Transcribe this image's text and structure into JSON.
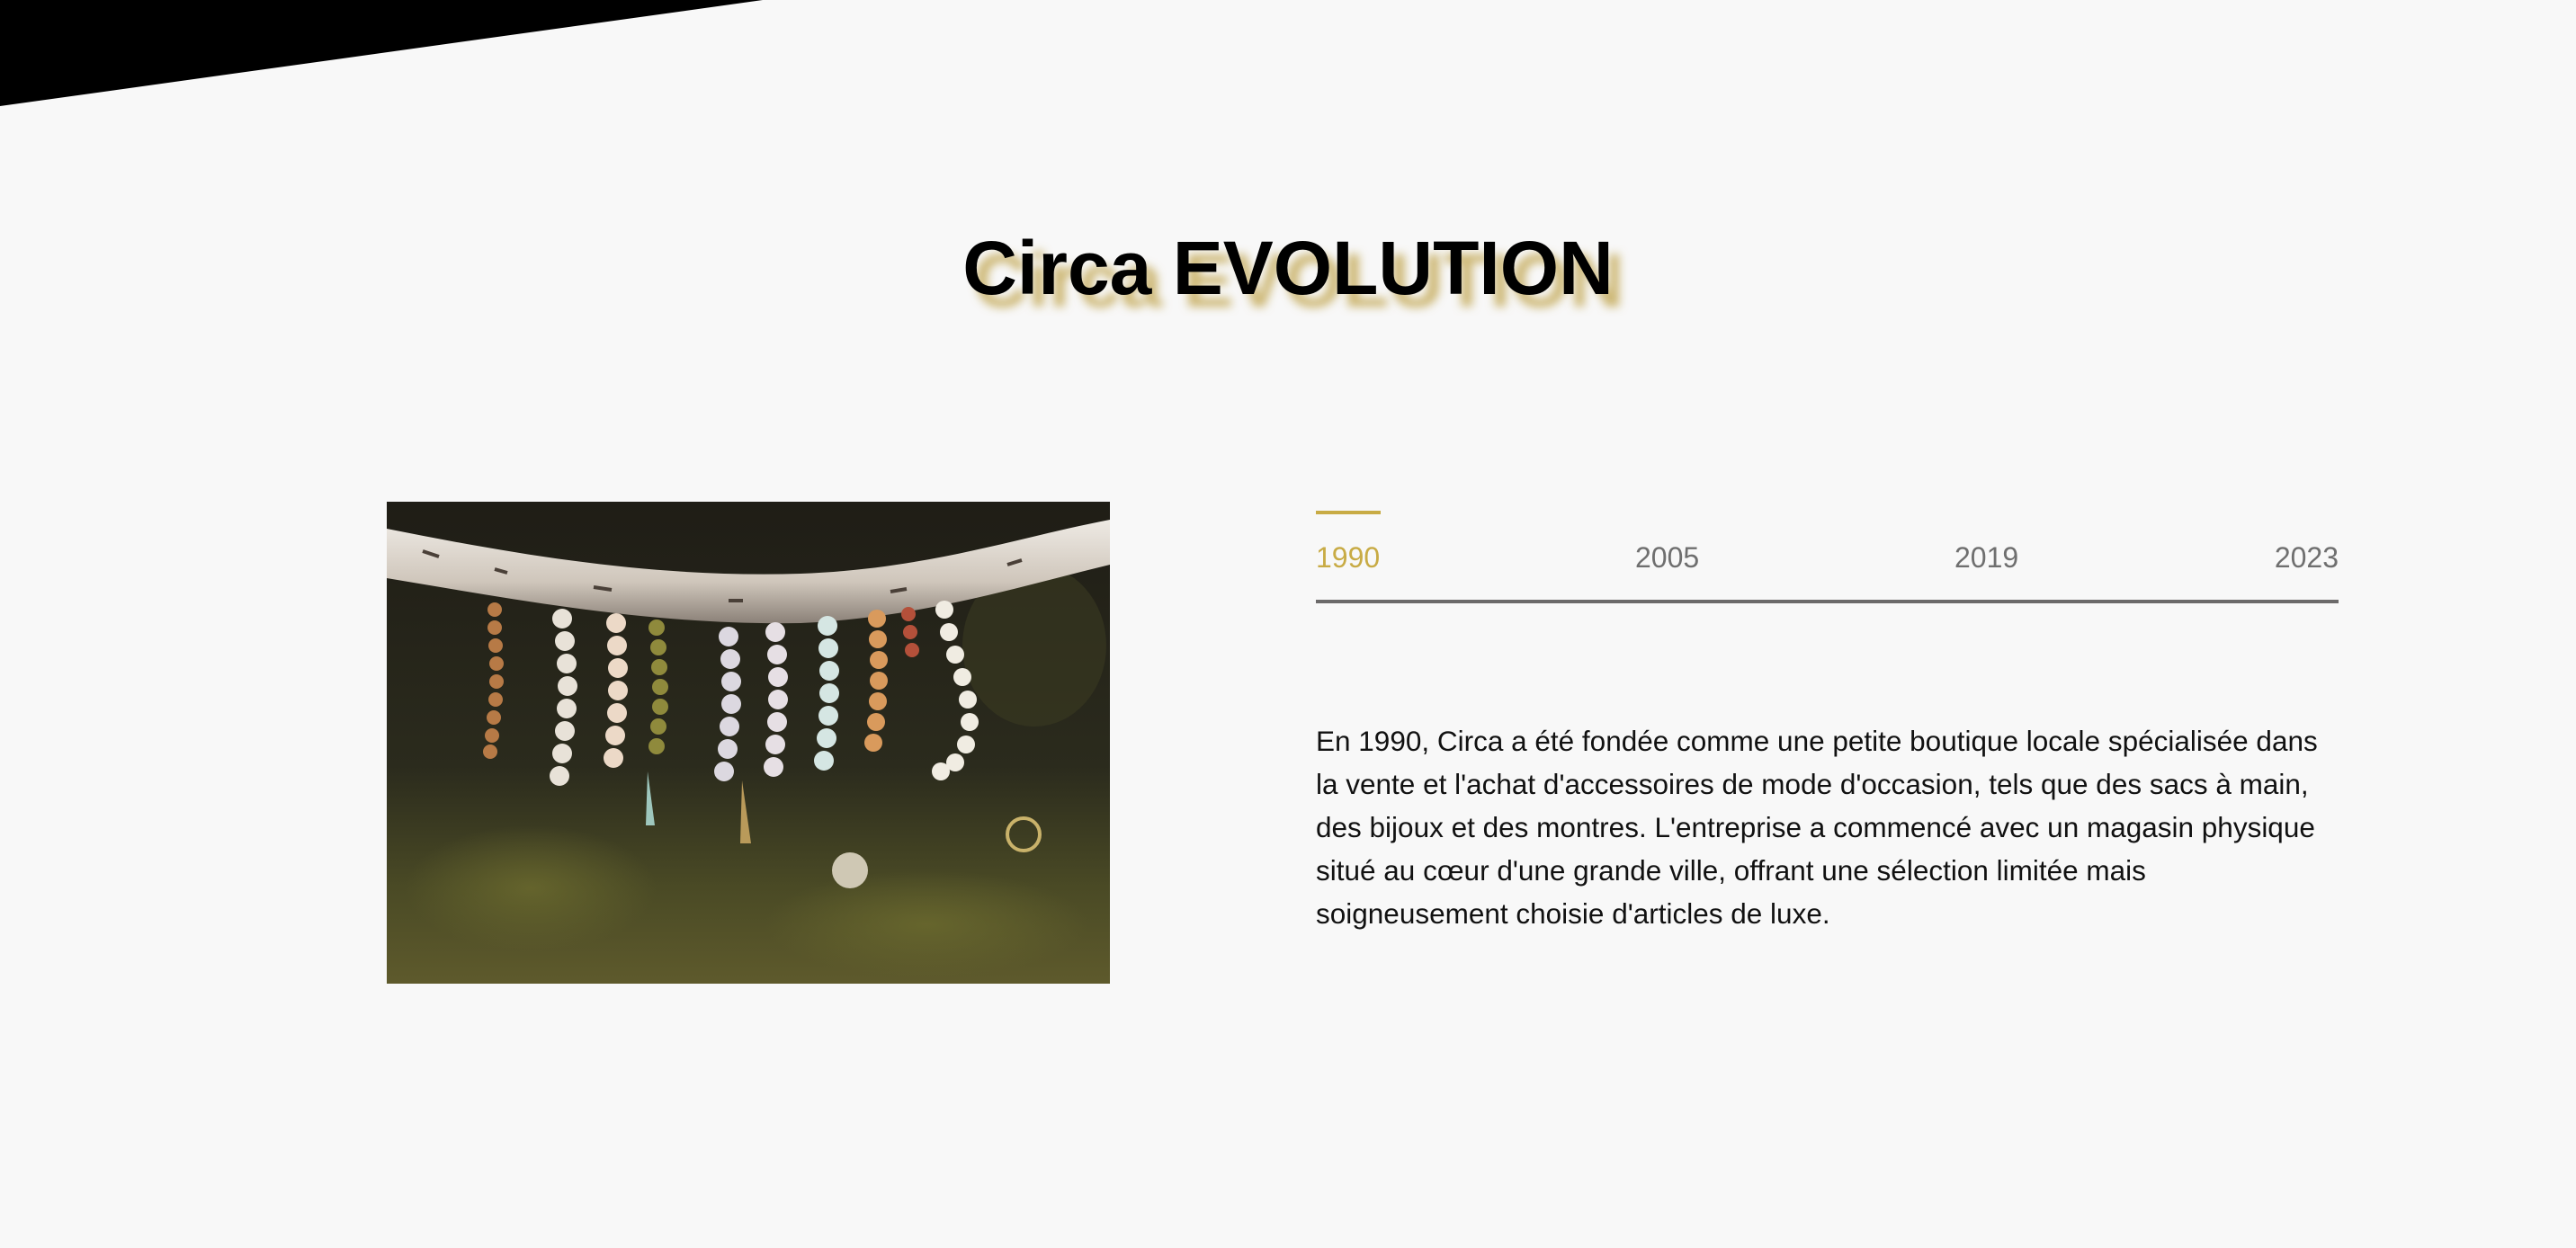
{
  "page": {
    "title": "Circa EVOLUTION"
  },
  "timeline": {
    "years": [
      {
        "label": "1990",
        "active": true
      },
      {
        "label": "2005",
        "active": false
      },
      {
        "label": "2019",
        "active": false
      },
      {
        "label": "2023",
        "active": false
      }
    ],
    "description": "En 1990, Circa a été fondée comme une petite boutique locale spécialisée dans la vente et l'achat d'accessoires de mode d'occasion, tels que des sacs à main, des bijoux et des montres. L'entreprise a commencé avec un magasin physique situé au cœur d'une grande ville, offrant une sélection limitée mais soigneusement choisie d'articles de luxe."
  },
  "colors": {
    "background": "#f8f8f8",
    "accent_gold": "#c8ab45",
    "inactive_year": "#6f6f6f",
    "timeline_line": "#6c6a6a",
    "text": "#111111",
    "corner_shape": "#000000"
  }
}
